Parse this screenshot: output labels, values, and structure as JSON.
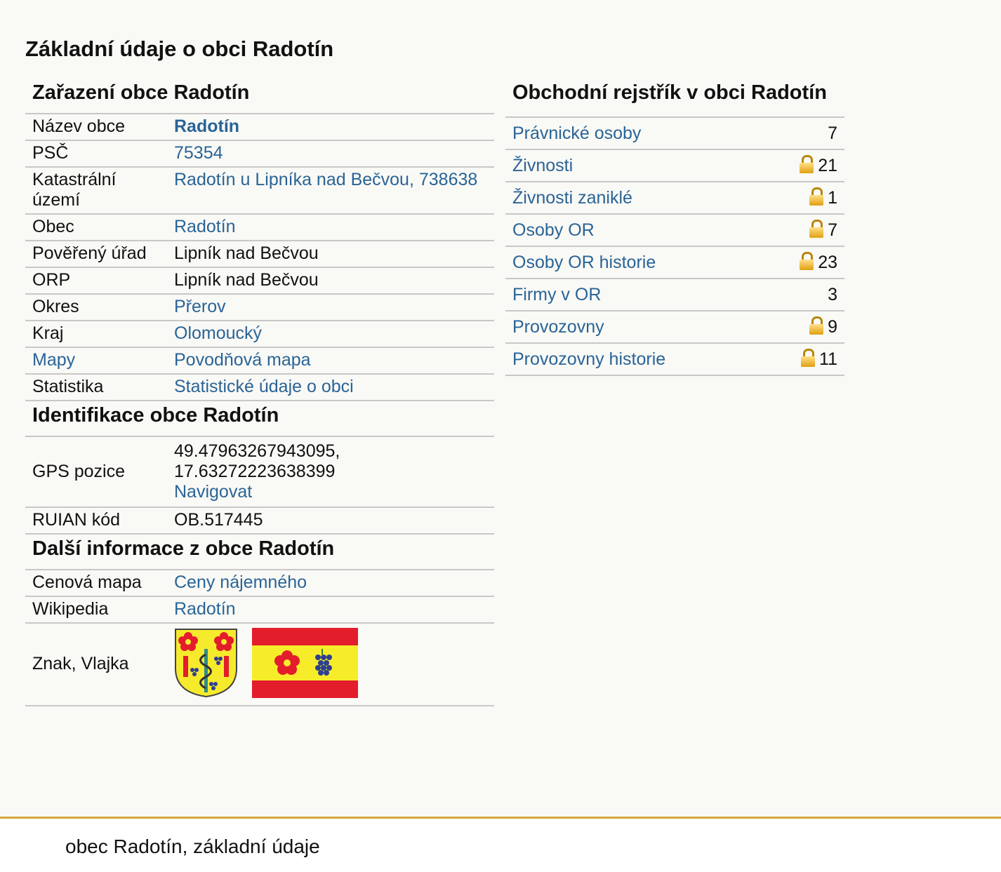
{
  "page_title": "Základní údaje o obci Radotín",
  "zarazeni": {
    "heading": "Zařazení obce Radotín",
    "rows": [
      {
        "key": "Název obce",
        "value": "Radotín"
      },
      {
        "key": "PSČ",
        "value": "75354"
      },
      {
        "key": "Katastrální území",
        "value": "Radotín u Lipníka nad Bečvou, 738638"
      },
      {
        "key": "Obec",
        "value": "Radotín"
      },
      {
        "key": "Pověřený úřad",
        "value": "Lipník nad Bečvou"
      },
      {
        "key": "ORP",
        "value": "Lipník nad Bečvou"
      },
      {
        "key": "Okres",
        "value": "Přerov"
      },
      {
        "key": "Kraj",
        "value": "Olomoucký"
      },
      {
        "key": "Mapy",
        "value": "Povodňová mapa"
      },
      {
        "key": "Statistika",
        "value": "Statistické údaje o obci"
      }
    ]
  },
  "identifikace": {
    "heading": "Identifikace obce Radotín",
    "gps_label": "GPS pozice",
    "gps_lat": "49.47963267943095,",
    "gps_lon": "17.63272223638399",
    "navigate": "Navigovat",
    "ruian_label": "RUIAN kód",
    "ruian_value": "OB.517445"
  },
  "dalsi": {
    "heading": "Další informace z obce Radotín",
    "cenova_label": "Cenová mapa",
    "cenova_value": "Ceny nájemného",
    "wiki_label": "Wikipedia",
    "wiki_value": "Radotín",
    "znak_label": "Znak, Vlajka"
  },
  "rejstrik": {
    "heading": "Obchodní rejstřík v obci Radotín",
    "rows": [
      {
        "label": "Právnické osoby",
        "count": "7",
        "locked": false
      },
      {
        "label": "Živnosti",
        "count": "21",
        "locked": true
      },
      {
        "label": "Živnosti zaniklé",
        "count": "1",
        "locked": true
      },
      {
        "label": "Osoby OR",
        "count": "7",
        "locked": true
      },
      {
        "label": "Osoby OR historie",
        "count": "23",
        "locked": true
      },
      {
        "label": "Firmy v OR",
        "count": "3",
        "locked": false
      },
      {
        "label": "Provozovny",
        "count": "9",
        "locked": true
      },
      {
        "label": "Provozovny historie",
        "count": "11",
        "locked": true
      }
    ]
  },
  "footer": "obec Radotín, základní údaje",
  "colors": {
    "link": "#2a6496",
    "accent": "#d4a93a",
    "flag_red": "#e31d2c",
    "flag_yellow": "#f7ec2a"
  }
}
